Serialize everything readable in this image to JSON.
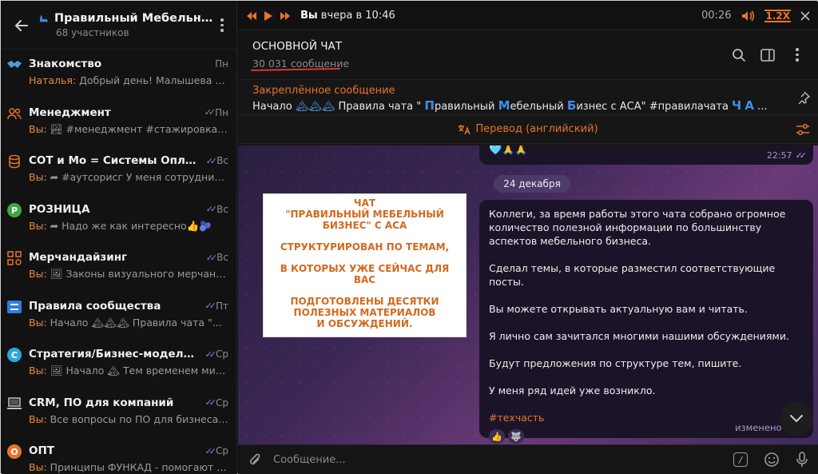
{
  "sidebar": {
    "group_title": "Правильный Мебельный ...",
    "group_members": "68 участников",
    "topics": [
      {
        "name": "Знакомство",
        "time": "Пн",
        "read": false,
        "who": "Наталья:",
        "preview": " Добрый день!  Малышева На...",
        "icon": "handshake-icon",
        "color": "#4a9de0"
      },
      {
        "name": "Менеджмент",
        "time": "Пн",
        "read": true,
        "who": "Вы:",
        "preview": " 🏞 #менеджмент #стажировка #к...",
        "icon": "people-icon",
        "color": "#e8742b"
      },
      {
        "name": "СОТ и Мо = Системы Оплаты Тр...",
        "time": "Вс",
        "read": true,
        "who": "Вы:",
        "preview": " ➦ #аутсорисг У меня сотрудник в...",
        "icon": "coins-icon",
        "color": "#e8742b"
      },
      {
        "name": "РОЗНИЦА",
        "time": "Вс",
        "read": true,
        "who": "Вы:",
        "preview": " ➦ Надо же как интересно👍🫐",
        "icon": "retail-icon",
        "color": "#3da843"
      },
      {
        "name": "Мерчандайзинг",
        "time": "Вс",
        "read": true,
        "who": "Вы:",
        "preview": " 🖼 Законы визуального мерчанд...",
        "icon": "grid-icon",
        "color": "#e8742b"
      },
      {
        "name": "Правила сообщества",
        "time": "Пт",
        "read": true,
        "who": "Вы:",
        "preview": " Начало 🏔🏔🏔 Правила чата \"...",
        "icon": "rules-icon",
        "color": "#2f7de1"
      },
      {
        "name": "Стратегия/Бизнес-модель/Ма...",
        "time": "Ср",
        "read": true,
        "who": "Вы:",
        "preview": " 🖼 Начало 🏔 Тем временем мир...",
        "icon": "strategy-icon",
        "color": "#2fa7d8"
      },
      {
        "name": "CRM, ПО для компаний",
        "time": "Ср",
        "read": true,
        "who": "Вы:",
        "preview": " Все вопросы по ПО для бизнеса, С...",
        "icon": "laptop-icon",
        "color": "#bdbdbd"
      },
      {
        "name": "ОПТ",
        "time": "Ср",
        "read": true,
        "who": "Вы:",
        "preview": " Принципы ФУНКАД - помогают вы...",
        "icon": "wholesale-icon",
        "color": "#e8742b"
      }
    ]
  },
  "player": {
    "who": "Вы",
    "when": " вчера в 10:46",
    "time": "00:26",
    "speed": "1.2X"
  },
  "chat": {
    "title": "ОСНОВНОЙ ЧАТ",
    "subtitle": "30 031 сообщение",
    "pinned_label": "Закреплённое сообщение",
    "pinned_text_a": "Начало ",
    "pinned_mtn": "🏔🏔🏔",
    "pinned_text_b": " Правила чата \" ",
    "pinned_p": "П",
    "pinned_text_c": "равильный ",
    "pinned_m": "М",
    "pinned_text_d": "ебельный ",
    "pinned_b": "Б",
    "pinned_text_e": "изнес с АСА\" #правилачата  ",
    "pinned_ch": "Ч",
    "pinned_a": "А",
    "pinned_tail": " ...",
    "translate_label": "Перевод (английский)",
    "prev_reactions": "🩵🙏🙏",
    "prev_time": "22:57",
    "date": "24 декабря",
    "overlay_lines": [
      "ЧАТ",
      "\"ПРАВИЛЬНЫЙ МЕБЕЛЬНЫЙ",
      "БИЗНЕС\" С АСА",
      "",
      "СТРУКТУРИРОВАН ПО ТЕМАМ,",
      "",
      "В КОТОРЫХ УЖЕ СЕЙЧАС ДЛЯ ВАС",
      "",
      "ПОДГОТОВЛЕНЫ ДЕСЯТКИ",
      "ПОЛЕЗНЫХ МАТЕРИАЛОВ",
      "И ОБСУЖДЕНИЙ."
    ],
    "message": {
      "p1": "Коллеги, за время работы этого чата собрано огромное количество полезной информации по большинству аспектов мебельного бизнеса.",
      "p2": "Сделал темы, в которые разместил соответствующие посты.",
      "p3": "Вы можете открывать актуальную вам и читать.",
      "p4": "Я лично сам зачитался многими нашими обсуждениями.",
      "p5": "Будут предложения по структуре тем, пишите.",
      "p6": "У меня ряд идей уже возникло.",
      "tag": "#техчасть",
      "reaction_1": "👍",
      "reaction_2": "🐺",
      "edited": "изменено 2:48"
    },
    "composer_placeholder": "Сообщение..."
  }
}
